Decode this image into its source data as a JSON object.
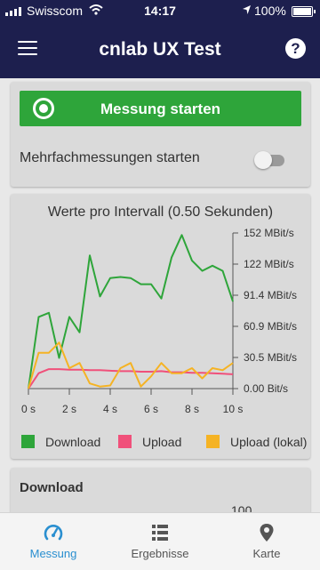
{
  "status_bar": {
    "carrier": "Swisscom",
    "time": "14:17",
    "battery": "100%"
  },
  "app_bar": {
    "title": "cnlab UX Test",
    "help_symbol": "?"
  },
  "controls": {
    "start_button_label": "Messung starten",
    "multi_label": "Mehrfachmessungen starten",
    "multi_enabled": false
  },
  "chart_data": {
    "type": "line",
    "title": "Werte pro Intervall (0.50 Sekunden)",
    "xlabel": "",
    "ylabel": "",
    "x": [
      0,
      0.5,
      1,
      1.5,
      2,
      2.5,
      3,
      3.5,
      4,
      4.5,
      5,
      5.5,
      6,
      6.5,
      7,
      7.5,
      8,
      8.5,
      9,
      9.5,
      10
    ],
    "xlim": [
      0,
      10
    ],
    "ylim": [
      0,
      152
    ],
    "x_ticks": [
      "0 s",
      "2 s",
      "4 s",
      "6 s",
      "8 s",
      "10 s"
    ],
    "y_ticks": [
      "0.00 Bit/s",
      "30.5 MBit/s",
      "60.9 MBit/s",
      "91.4 MBit/s",
      "122 MBit/s",
      "152 MBit/s"
    ],
    "series": [
      {
        "name": "Download",
        "color": "#2ea53a",
        "values": [
          0,
          70,
          74,
          30,
          70,
          55,
          130,
          90,
          108,
          109,
          108,
          102,
          102,
          88,
          128,
          150,
          125,
          115,
          120,
          115,
          85
        ]
      },
      {
        "name": "Upload",
        "color": "#f0507a",
        "values": [
          0,
          15,
          19,
          19,
          18.5,
          18.5,
          18,
          18,
          17.5,
          17,
          17,
          16.5,
          16.5,
          17,
          16,
          16,
          15.5,
          15.5,
          15,
          14.5,
          14
        ]
      },
      {
        "name": "Upload (lokal)",
        "color": "#f5b324",
        "values": [
          0,
          35,
          35,
          45,
          20,
          25,
          5,
          2,
          3,
          20,
          25,
          2,
          12,
          25,
          15,
          15,
          20,
          10,
          20,
          18,
          25
        ]
      }
    ]
  },
  "download_card": {
    "title": "Download",
    "peek_value": "100"
  },
  "nav": [
    {
      "label": "Messung",
      "icon": "speedometer-icon",
      "active": true
    },
    {
      "label": "Ergebnisse",
      "icon": "list-icon",
      "active": false
    },
    {
      "label": "Karte",
      "icon": "map-pin-icon",
      "active": false
    }
  ],
  "colors": {
    "header": "#1d1f4e",
    "accent_green": "#2ea53a",
    "nav_active": "#2a8fd0"
  }
}
